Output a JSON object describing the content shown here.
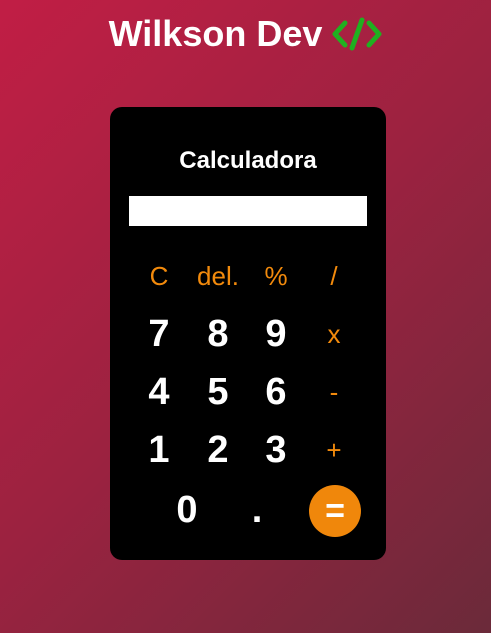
{
  "brand": {
    "name": "Wilkson Dev",
    "icon": "code-icon",
    "icon_color": "#20b020"
  },
  "calculator": {
    "title": "Calculadora",
    "display_value": "",
    "accent_color": "#f0870b",
    "keys": {
      "clear": "C",
      "delete": "del.",
      "percent": "%",
      "divide": "/",
      "seven": "7",
      "eight": "8",
      "nine": "9",
      "multiply": "x",
      "four": "4",
      "five": "5",
      "six": "6",
      "subtract": "-",
      "one": "1",
      "two": "2",
      "three": "3",
      "add": "+",
      "zero": "0",
      "decimal": ".",
      "equals": "="
    }
  }
}
